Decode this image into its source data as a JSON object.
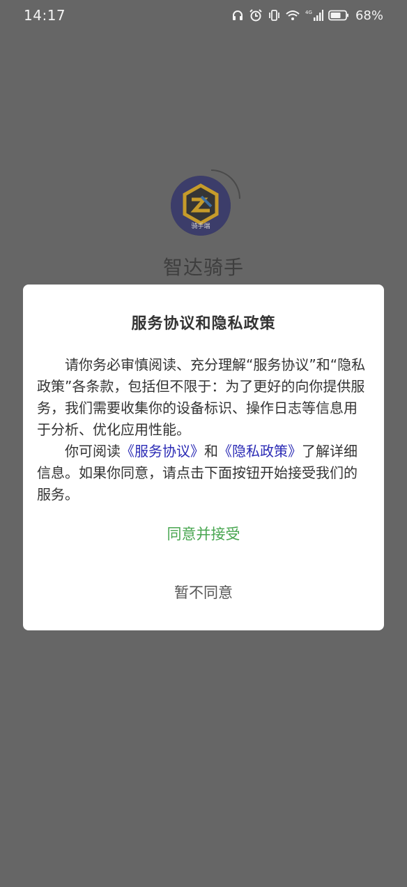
{
  "status_bar": {
    "time": "14:17",
    "battery": "68%",
    "network": "4G",
    "icons": [
      "headphones-icon",
      "alarm-icon",
      "vibrate-icon",
      "wifi-icon",
      "signal-icon",
      "battery-icon"
    ]
  },
  "app": {
    "logo_caption": "骑手端",
    "name": "智达骑手"
  },
  "dialog": {
    "title": "服务协议和隐私政策",
    "paragraph1": "请你务必审慎阅读、充分理解“服务协议”和“隐私政策”各条款，包括但不限于：为了更好的向你提供服务，我们需要收集你的设备标识、操作日志等信息用于分析、优化应用性能。",
    "p2_prefix": "你可阅读",
    "service_link": "《服务协议》",
    "p2_and": "和",
    "privacy_link": "《隐私政策》",
    "p2_suffix": "了解详细信息。如果你同意，请点击下面按钮开始接受我们的服务。",
    "agree_label": "同意并接受",
    "decline_label": "暂不同意"
  },
  "colors": {
    "overlay": "#666666",
    "agree": "#48a650",
    "link": "#2b2bb5"
  }
}
